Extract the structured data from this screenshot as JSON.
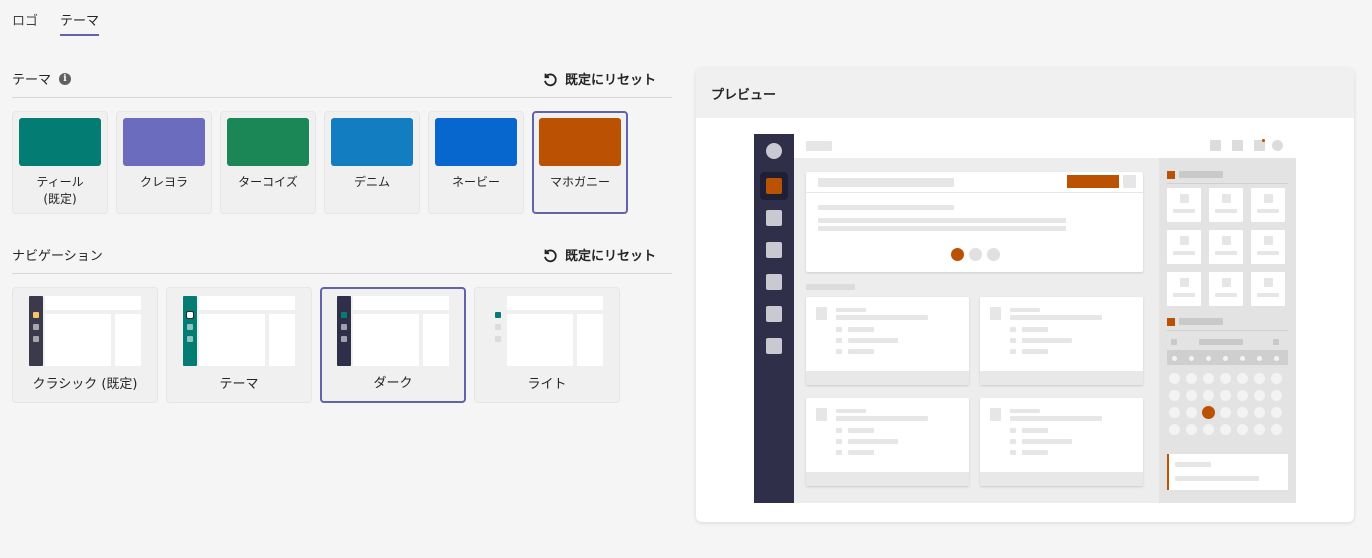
{
  "tabs": [
    {
      "label": "ロゴ",
      "active": false
    },
    {
      "label": "テーマ",
      "active": true
    }
  ],
  "theme_section": {
    "title": "テーマ",
    "info_icon": "info-icon",
    "reset_label": "既定にリセット",
    "reset_icon": "reset-arrow-icon",
    "options": [
      {
        "label": "ティール\n(既定)",
        "color": "#037c74",
        "selected": false
      },
      {
        "label": "クレヨラ",
        "color": "#6b6cbe",
        "selected": false
      },
      {
        "label": "ターコイズ",
        "color": "#1b8656",
        "selected": false
      },
      {
        "label": "デニム",
        "color": "#127dc0",
        "selected": false
      },
      {
        "label": "ネービー",
        "color": "#0866cf",
        "selected": false
      },
      {
        "label": "マホガニー",
        "color": "#bb5103",
        "selected": true
      }
    ]
  },
  "nav_section": {
    "title": "ナビゲーション",
    "reset_label": "既定にリセット",
    "options": [
      {
        "label": "クラシック (既定)",
        "bar_color": "#3a3a4a",
        "active_dot": "#f7c36b",
        "selected": false
      },
      {
        "label": "テーマ",
        "bar_color": "#037c74",
        "active_dot": "#ffffff",
        "selected": false
      },
      {
        "label": "ダーク",
        "bar_color": "#2f2f4a",
        "active_dot": "#037c74",
        "selected": true
      },
      {
        "label": "ライト",
        "bar_color": "#f0f0f0",
        "active_dot": "#037c74",
        "selected": false
      }
    ]
  },
  "preview": {
    "title": "プレビュー",
    "accent_color": "#bb5103",
    "rail_color": "#2f2f4a"
  }
}
